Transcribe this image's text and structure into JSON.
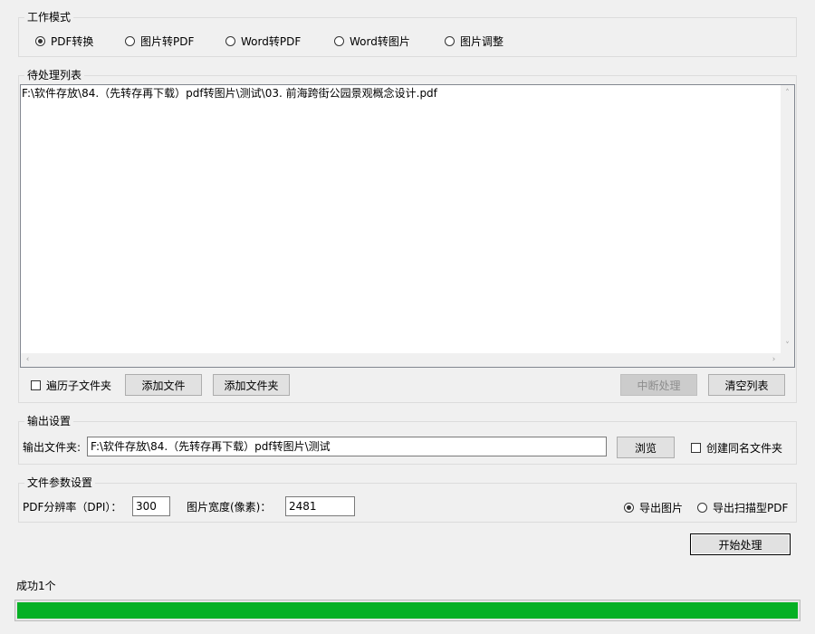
{
  "work_mode": {
    "title": "工作模式",
    "options": [
      "PDF转换",
      "图片转PDF",
      "Word转PDF",
      "Word转图片",
      "图片调整"
    ],
    "selected": "PDF转换"
  },
  "pending_list": {
    "title": "待处理列表",
    "items": [
      "F:\\软件存放\\84.（先转存再下载）pdf转图片\\测试\\03. 前海跨街公园景观概念设计.pdf"
    ],
    "traverse_subfolders_label": "遍历子文件夹",
    "traverse_subfolders_checked": false,
    "add_file_label": "添加文件",
    "add_folder_label": "添加文件夹",
    "interrupt_label": "中断处理",
    "clear_list_label": "清空列表"
  },
  "output_settings": {
    "title": "输出设置",
    "folder_label": "输出文件夹:",
    "folder_value": "F:\\软件存放\\84.（先转存再下载）pdf转图片\\测试",
    "browse_label": "浏览",
    "create_same_name_folder_label": "创建同名文件夹",
    "create_same_name_folder_checked": false
  },
  "file_params": {
    "title": "文件参数设置",
    "dpi_label": "PDF分辨率（DPI）：",
    "dpi_value": "300",
    "width_label": "图片宽度(像素)：",
    "width_value": "2481",
    "export_images_label": "导出图片",
    "export_scanned_pdf_label": "导出扫描型PDF",
    "export_selected": "导出图片"
  },
  "start_label": "开始处理",
  "status_text": "成功1个",
  "progress_fraction": 1.0,
  "colors": {
    "progress": "#06b025"
  }
}
